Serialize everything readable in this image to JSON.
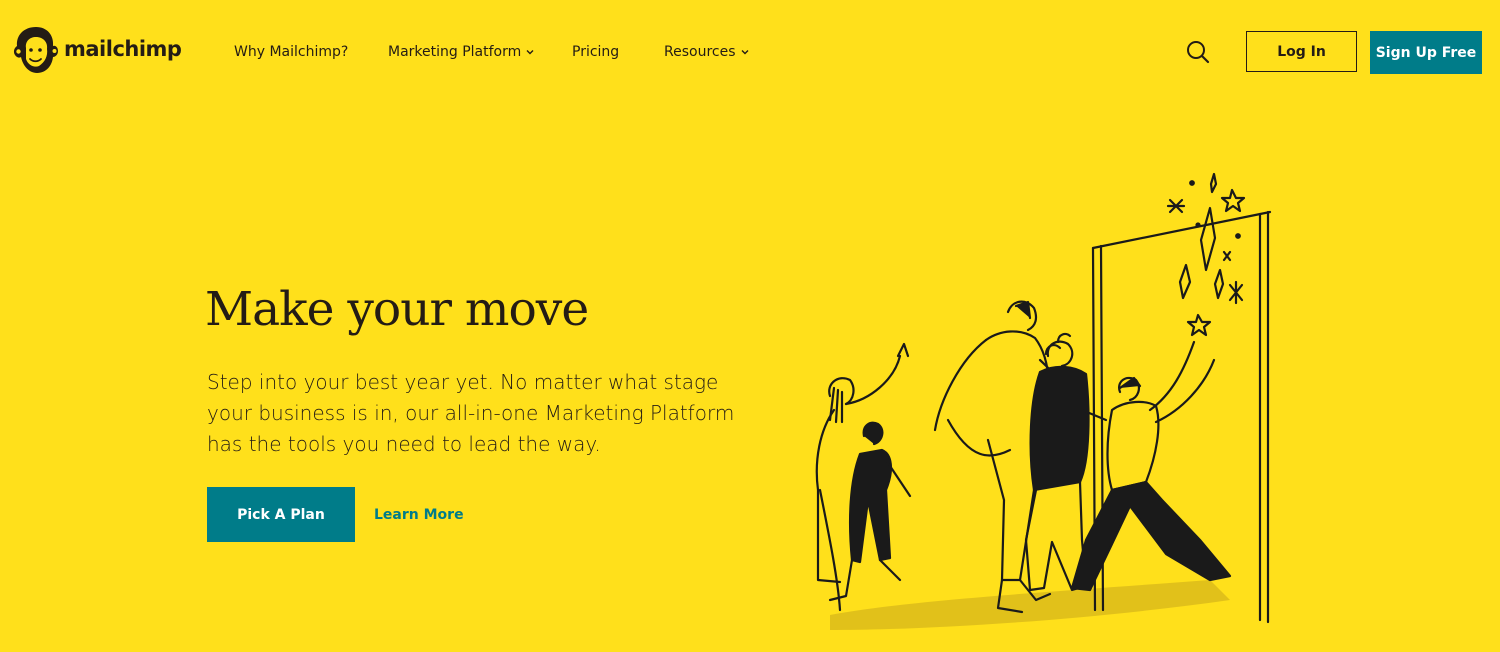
{
  "brand": {
    "name": "mailchimp",
    "logo_icon": "freddie-chimp-logo-icon"
  },
  "nav": {
    "items": [
      {
        "label": "Why Mailchimp?",
        "has_dropdown": false
      },
      {
        "label": "Marketing Platform",
        "has_dropdown": true
      },
      {
        "label": "Pricing",
        "has_dropdown": false
      },
      {
        "label": "Resources",
        "has_dropdown": true
      }
    ],
    "search_icon": "search-icon",
    "login_label": "Log In",
    "signup_label": "Sign Up Free"
  },
  "hero": {
    "title": "Make your move",
    "subtitle": "Step into your best year yet. No matter what stage your business is in, our all-in-one Marketing Platform has the tools you need to lead the way.",
    "primary_cta": "Pick A Plan",
    "secondary_cta": "Learn More",
    "illustration": "people-walking-through-doorway-illustration"
  },
  "colors": {
    "background": "#FFE01B",
    "text": "#241C15",
    "accent": "#007C89",
    "button_text": "#FFFFFF"
  }
}
